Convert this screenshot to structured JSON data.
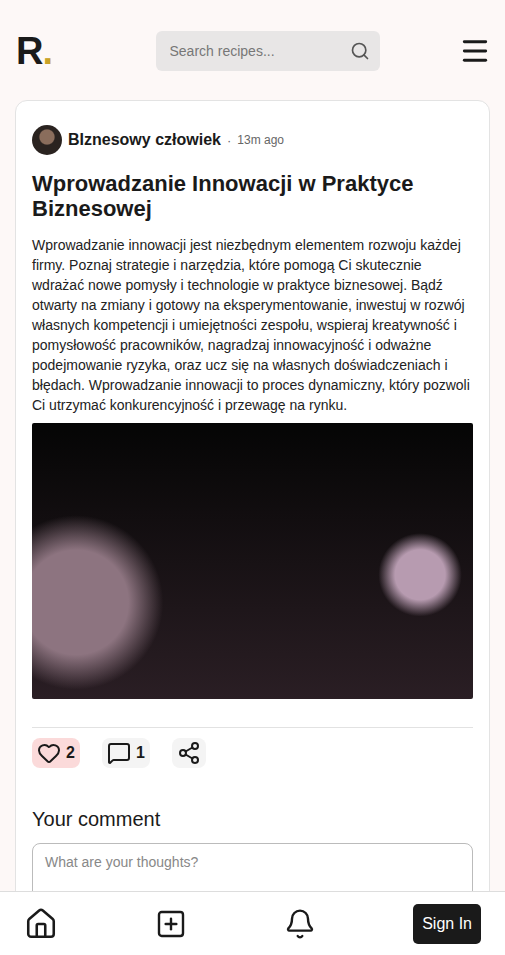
{
  "header": {
    "logo": {
      "letter": "R",
      "accent": "."
    },
    "search": {
      "placeholder": "Search recipes..."
    }
  },
  "post": {
    "author": "BIznesowy człowiek",
    "separator": "·",
    "time": "13m ago",
    "title": "Wprowadzanie Innowacji w Praktyce Biznesowej",
    "body": "Wprowadzanie innowacji jest niezbędnym elementem rozwoju każdej firmy. Poznaj strategie i narzędzia, które pomogą Ci skutecznie wdrażać nowe pomysły i technologie w praktyce biznesowej. Bądź otwarty na zmiany i gotowy na eksperymentowanie, inwestuj w rozwój własnych kompetencji i umiejętności zespołu, wspieraj kreatywność i pomysłowość pracowników, nagradzaj innowacyjność i odważne podejmowanie ryzyka, oraz ucz się na własnych doświadczeniach i błędach. Wprowadzanie innowacji to proces dynamiczny, który pozwoli Ci utrzymać konkurencyjność i przewagę na rynku.",
    "likes": {
      "count": "2",
      "liked": true
    },
    "comments": {
      "count": "1"
    }
  },
  "comment_form": {
    "label": "Your comment",
    "placeholder": "What are your thoughts?"
  },
  "bottom_nav": {
    "sign_in": "Sign In"
  }
}
